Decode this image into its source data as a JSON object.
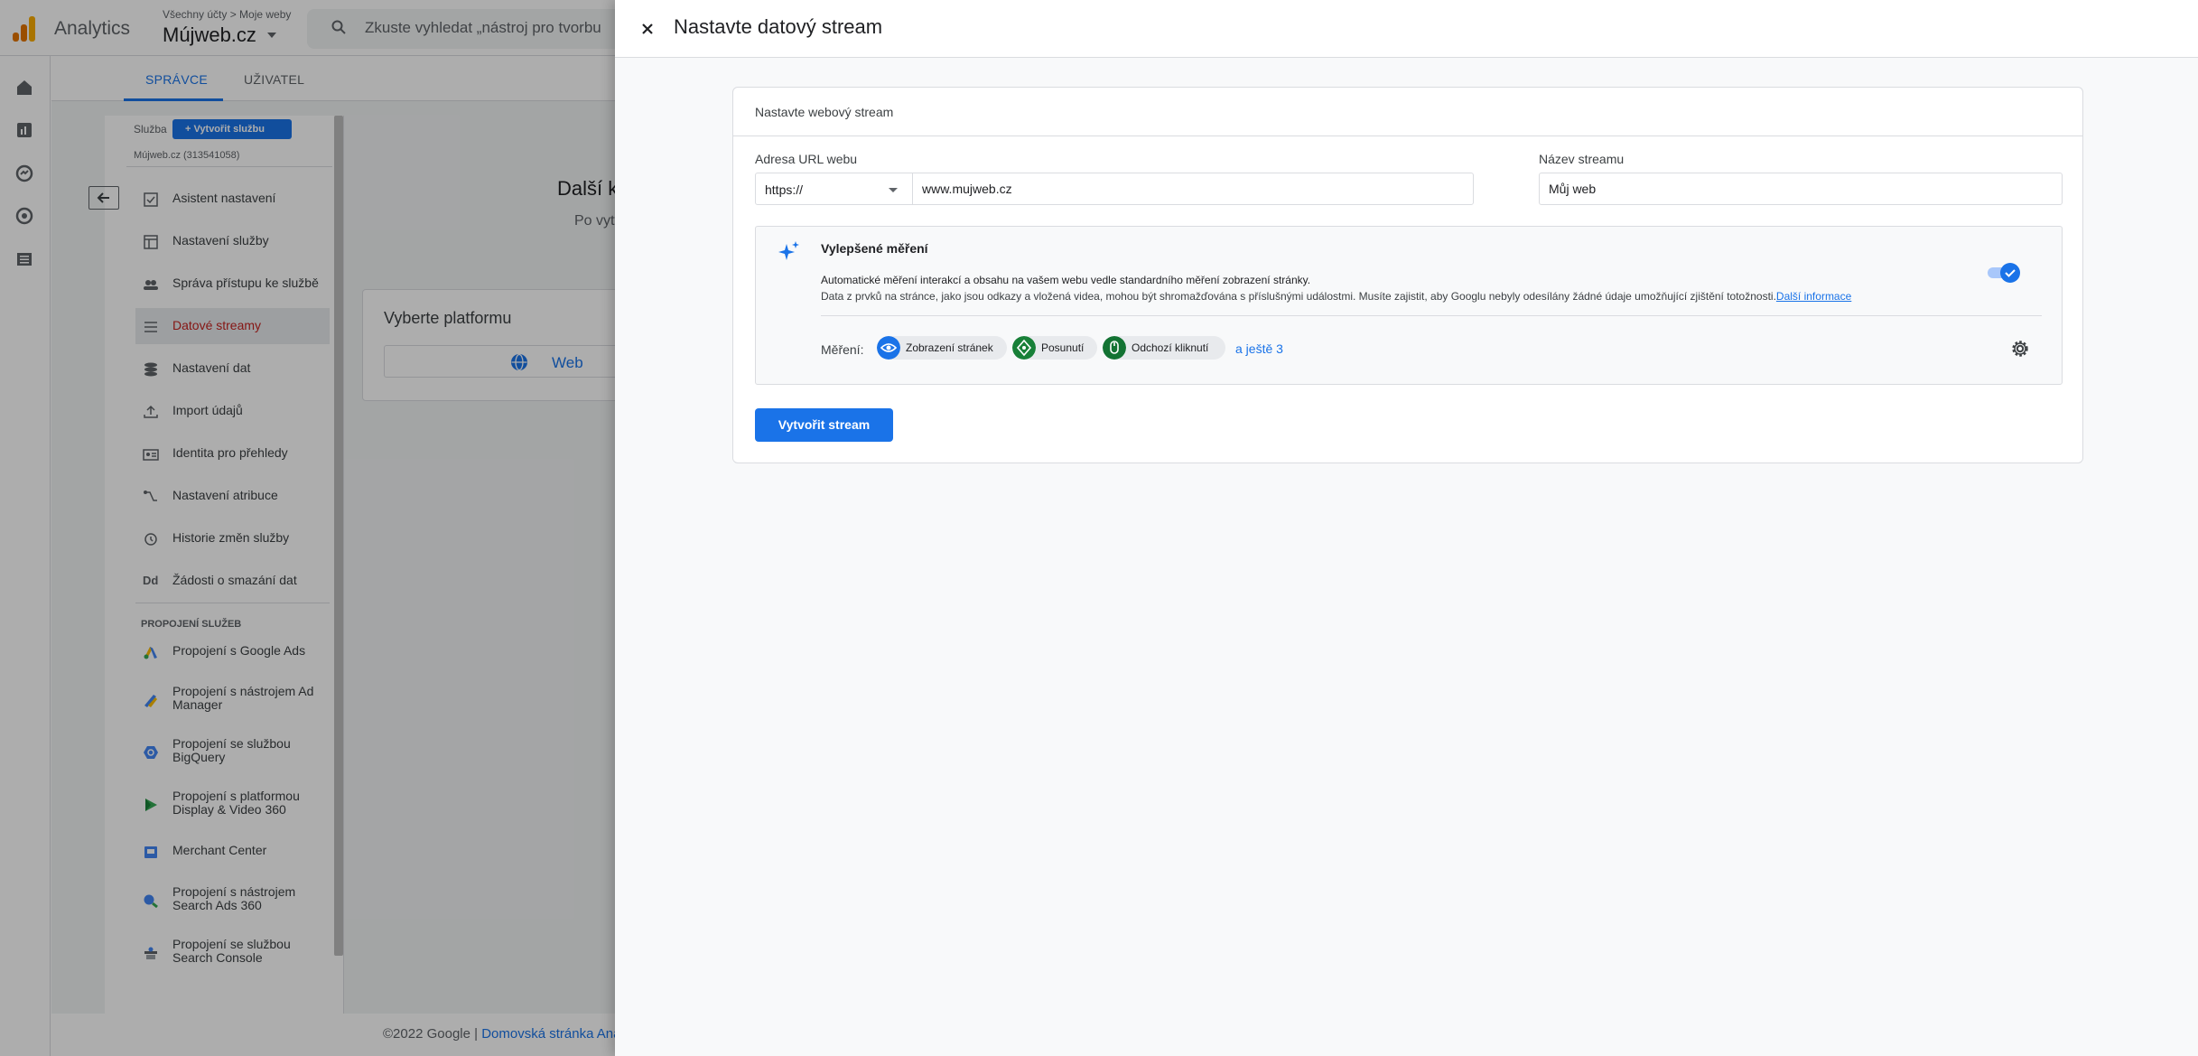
{
  "app": {
    "name": "Analytics",
    "breadcrumb": "Všechny účty > Moje weby",
    "property": "Mújweb.cz",
    "search_placeholder": "Zkuste vyhledat „nástroj pro tvorbu"
  },
  "tabs": [
    "SPRÁVCE",
    "UŽIVATEL"
  ],
  "admin": {
    "service_label": "Služba",
    "create_service": "Vytvořit službu",
    "service_name": "Mújweb.cz (313541058)",
    "menu": [
      {
        "label": "Asistent nastavení",
        "icon": "checkbox-icon"
      },
      {
        "label": "Nastavení služby",
        "icon": "layout-icon"
      },
      {
        "label": "Správa přístupu ke službě",
        "icon": "people-icon"
      },
      {
        "label": "Datové streamy",
        "icon": "streams-icon",
        "active": true
      },
      {
        "label": "Nastavení dat",
        "icon": "database-icon"
      },
      {
        "label": "Import údajů",
        "icon": "upload-icon"
      },
      {
        "label": "Identita pro přehledy",
        "icon": "identity-icon"
      },
      {
        "label": "Nastavení atribuce",
        "icon": "attribution-icon"
      },
      {
        "label": "Historie změn služby",
        "icon": "history-icon"
      },
      {
        "label": "Žádosti o smazání dat",
        "icon": "dd-icon"
      }
    ],
    "links_title": "PROPOJENÍ SLUŽEB",
    "links": [
      {
        "label": "Propojení s Google Ads",
        "icon": "google-ads-icon"
      },
      {
        "label": "Propojení s nástrojem Ad Manager",
        "icon": "ad-manager-icon"
      },
      {
        "label": "Propojení se službou BigQuery",
        "icon": "bigquery-icon"
      },
      {
        "label": "Propojení s platformou Display & Video 360",
        "icon": "dv360-icon"
      },
      {
        "label": "Merchant Center",
        "icon": "merchant-center-icon"
      },
      {
        "label": "Propojení s nástrojem Search Ads 360",
        "icon": "search-ads-icon"
      },
      {
        "label": "Propojení se službou Search Console",
        "icon": "search-console-icon"
      }
    ]
  },
  "main_bg": {
    "title_fragment": "Další k",
    "subtitle_fragment": "Po vytv",
    "platform_title": "Vyberte platformu",
    "web_label": "Web",
    "footer_text": "©2022 Google |",
    "footer_link": "Domovská stránka Ana"
  },
  "panel": {
    "title": "Nastavte datový stream",
    "card_title": "Nastavte webový stream",
    "url_label": "Adresa URL webu",
    "protocol": "https://",
    "url_value": "www.mujweb.cz",
    "name_label": "Název streamu",
    "name_value": "Můj web",
    "enhanced": {
      "title": "Vylepšené měření",
      "desc1": "Automatické měření interakcí a obsahu na vašem webu vedle standardního měření zobrazení stránky.",
      "desc2": "Data z prvků na stránce, jako jsou odkazy a vložená videa, mohou být shromažďována s příslušnými událostmi. Musíte zajistit, aby Googlu nebyly odesílány žádné údaje umožňující zjištění totožnosti.",
      "link": "Další informace",
      "enabled": true,
      "measure_label": "Měření:",
      "chips": [
        "Zobrazení stránek",
        "Posunutí",
        "Odchozí kliknutí"
      ],
      "more": "a ještě 3"
    },
    "create_button": "Vytvořit stream"
  },
  "colors": {
    "accent": "#1a73e8",
    "active_menu": "#c5221f",
    "scrim": "rgba(0,0,0,0.32)"
  }
}
